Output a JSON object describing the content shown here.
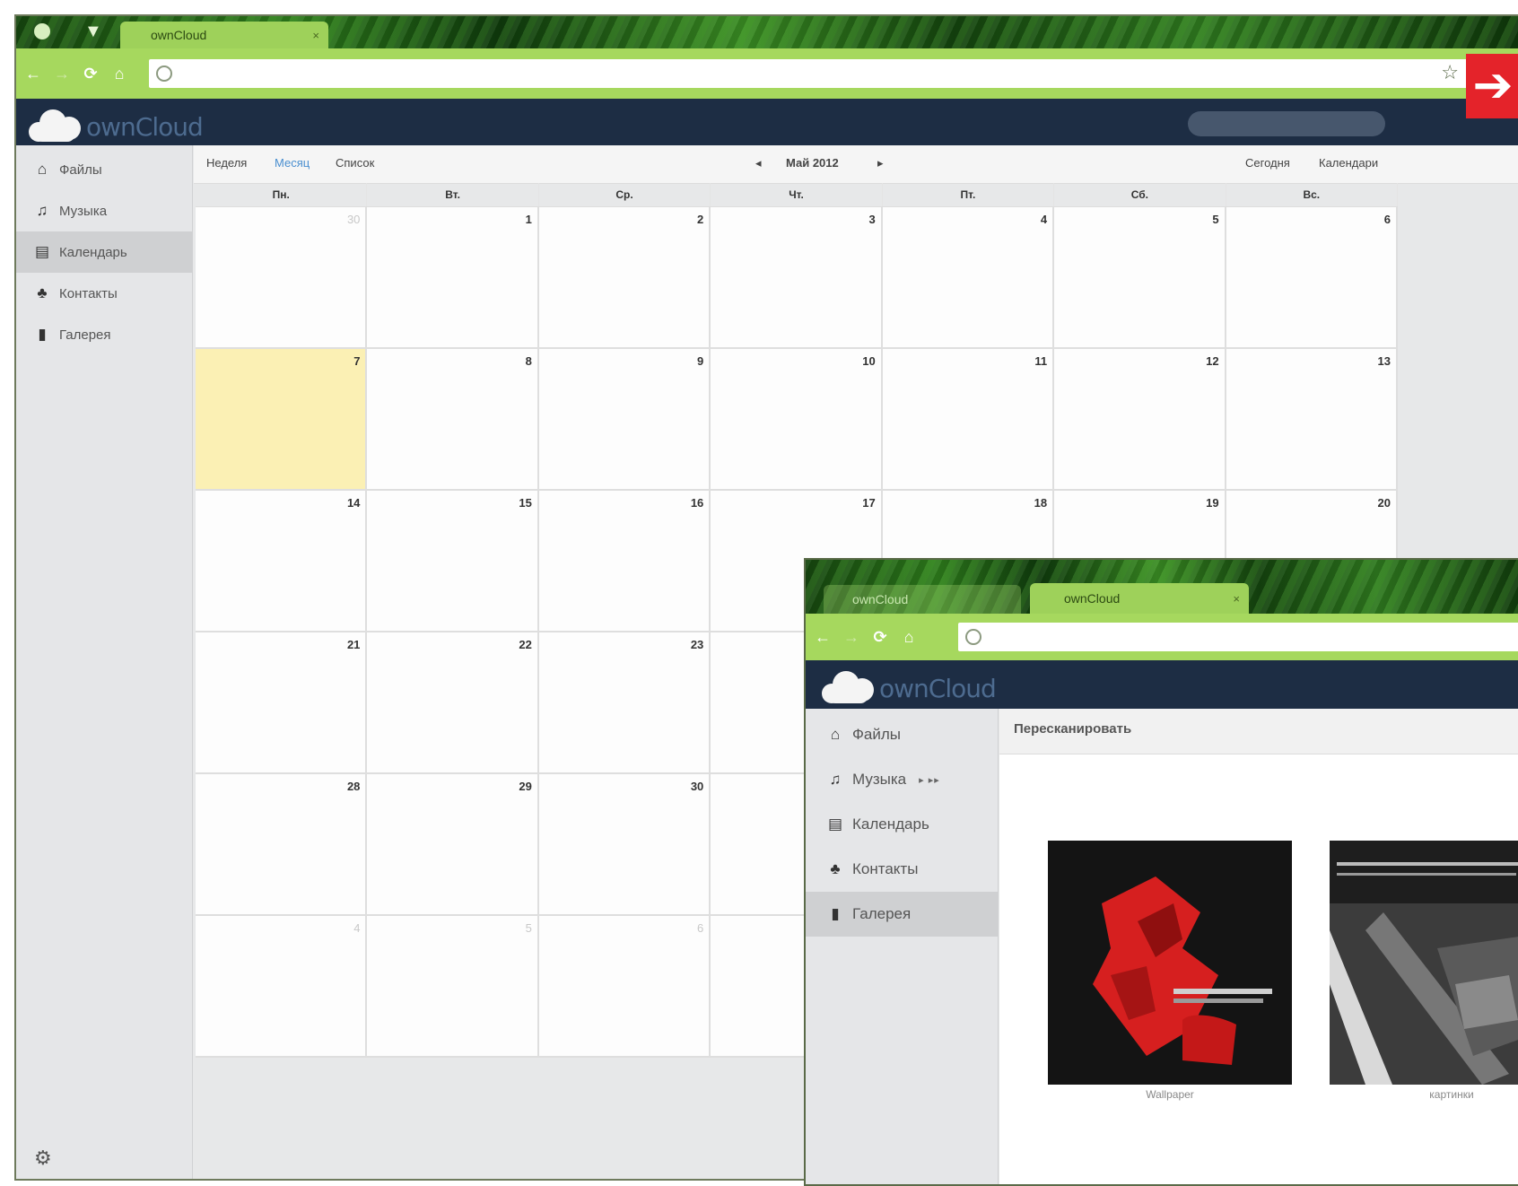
{
  "main_window": {
    "tab_title": "ownCloud",
    "nav": [
      {
        "label": "Файлы",
        "icon": "home-icon"
      },
      {
        "label": "Музыка",
        "icon": "music-note-icon"
      },
      {
        "label": "Календарь",
        "icon": "calendar-icon",
        "active": true
      },
      {
        "label": "Контакты",
        "icon": "contacts-icon"
      },
      {
        "label": "Галерея",
        "icon": "gallery-icon"
      }
    ],
    "calendar": {
      "views": [
        "Неделя",
        "Месяц",
        "Список"
      ],
      "selected_view": "Месяц",
      "prev": "◂",
      "next": "▸",
      "period": "Май 2012",
      "today_button": "Сегодня",
      "calendars_button": "Календари",
      "weekdays": [
        "Пн.",
        "Вт.",
        "Ср.",
        "Чт.",
        "Пт.",
        "Сб.",
        "Вс."
      ],
      "weeks": [
        [
          "30",
          "1",
          "2",
          "3",
          "4",
          "5",
          "6"
        ],
        [
          "7",
          "8",
          "9",
          "10",
          "11",
          "12",
          "13"
        ],
        [
          "14",
          "15",
          "16",
          "17",
          "18",
          "19",
          "20"
        ],
        [
          "21",
          "22",
          "23",
          "",
          "",
          "",
          ""
        ],
        [
          "28",
          "29",
          "30",
          "",
          "",
          "",
          ""
        ],
        [
          "4",
          "5",
          "6",
          "",
          "",
          "",
          ""
        ]
      ]
    }
  },
  "gallery_window": {
    "tab_titles": [
      "ownCloud",
      "ownCloud"
    ],
    "nav": [
      {
        "label": "Файлы",
        "icon": "home-icon"
      },
      {
        "label": "Музыка",
        "icon": "music-note-icon"
      },
      {
        "label": "Календарь",
        "icon": "calendar-icon"
      },
      {
        "label": "Контакты",
        "icon": "contacts-icon"
      },
      {
        "label": "Галерея",
        "icon": "gallery-icon",
        "active": true
      }
    ],
    "music_controls": "▸ ▸▸",
    "rescan_button": "Пересканировать",
    "albums": [
      {
        "label": "Wallpaper"
      },
      {
        "label": "картинки"
      }
    ]
  },
  "colors": {
    "chrome_green": "#a6d85e",
    "header_navy": "#1d2d44",
    "today_highlight": "#fbf0b4",
    "arrow_red": "#e4232a"
  }
}
